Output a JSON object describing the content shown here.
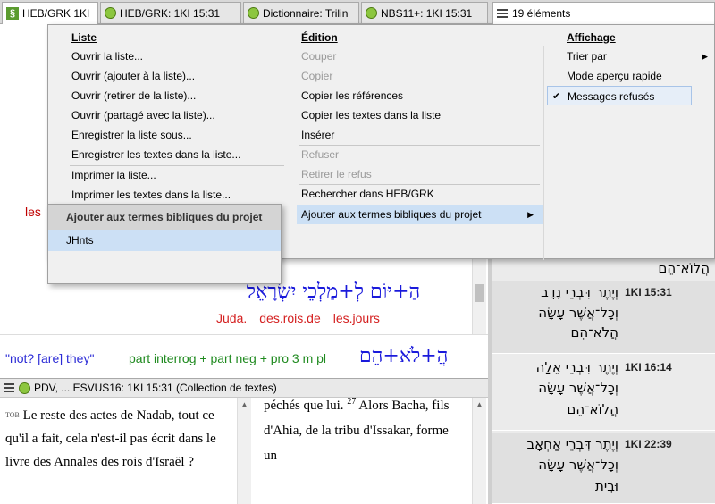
{
  "tabs": [
    {
      "label": "HEB/GRK 1KI",
      "icon": "heb-grk-icon",
      "active": true
    },
    {
      "label": "HEB/GRK: 1KI 15:31",
      "icon": "leaf-icon"
    },
    {
      "label": "Dictionnaire: Trilin",
      "icon": "leaf-icon"
    },
    {
      "label": "NBS11+: 1KI 15:31",
      "icon": "leaf-icon"
    },
    {
      "label": "19 éléments",
      "icon": "menu-icon"
    }
  ],
  "main": {
    "red_partial": "les",
    "interlinear_heb": "הַ+יּוֹם לְ+מַלְכֵי יִשְׂרָאֵל",
    "gloss_words": [
      "Juda.",
      "des.rois.de",
      "les.jours"
    ],
    "gloss_note": "\"not? [are] they\"",
    "gloss_parts": "part interrog + part neg + pro 3 m pl",
    "gloss_heb": "הֲ+לֹא+הֵם"
  },
  "bottom_pane": {
    "title": "PDV, ... ESVUS16: 1KI 15:31 (Collection de textes)",
    "left_version": "TOB",
    "left_text": "Le reste des actes de Nadab, tout ce qu'il a fait, cela n'est-il pas écrit dans le livre des Annales des rois d'Israël ?",
    "right_line1": "péchés que lui.",
    "right_verse": "27",
    "right_rest": "Alors Bacha, fils d'Ahia, de la tribu d'Issakar, forme un"
  },
  "list_panel": {
    "top_heb": "הֲלוֹא־הֵם",
    "rows": [
      {
        "ref": "1KI 15:31",
        "lines": [
          "וְיֶתֶר דִּבְרֵי נָדָב",
          "וְכָל־אֲשֶׁר עָשָׂה",
          "הֲלֹא־הֵם"
        ]
      },
      {
        "ref": "1KI 16:14",
        "lines": [
          "וְיֶתֶר דִּבְרֵי אֵלָה",
          "וְכָל־אֲשֶׁר עָשָׂה",
          "הֲלוֹא־הֵם"
        ]
      },
      {
        "ref": "1KI 22:39",
        "lines": [
          "וְיֶתֶר דִּבְרֵי אַחְאָב",
          "וְכָל־אֲשֶׁר עָשָׂה",
          "וּבֵית"
        ]
      }
    ]
  },
  "menu": {
    "col1": {
      "heading": "Liste",
      "items": [
        "Ouvrir la liste...",
        "Ouvrir (ajouter à la liste)...",
        "Ouvrir (retirer de la liste)...",
        "Ouvrir (partagé avec la liste)...",
        "Enregistrer la liste sous...",
        "Enregistrer les textes dans la liste...",
        "Imprimer la liste...",
        "Imprimer les textes dans la liste..."
      ]
    },
    "col2": {
      "heading": "Édition",
      "items": [
        "Couper",
        "Copier",
        "Copier les références",
        "Copier les textes dans la liste",
        "Insérer",
        "Refuser",
        "Retirer le refus",
        "Rechercher dans HEB/GRK",
        "Ajouter aux termes bibliques du projet"
      ]
    },
    "col3": {
      "heading": "Affichage",
      "items": [
        "Trier par",
        "Mode aperçu rapide",
        "Messages refusés"
      ]
    },
    "submenu": {
      "header": "Ajouter aux termes bibliques du projet",
      "item": "JHnts"
    }
  }
}
